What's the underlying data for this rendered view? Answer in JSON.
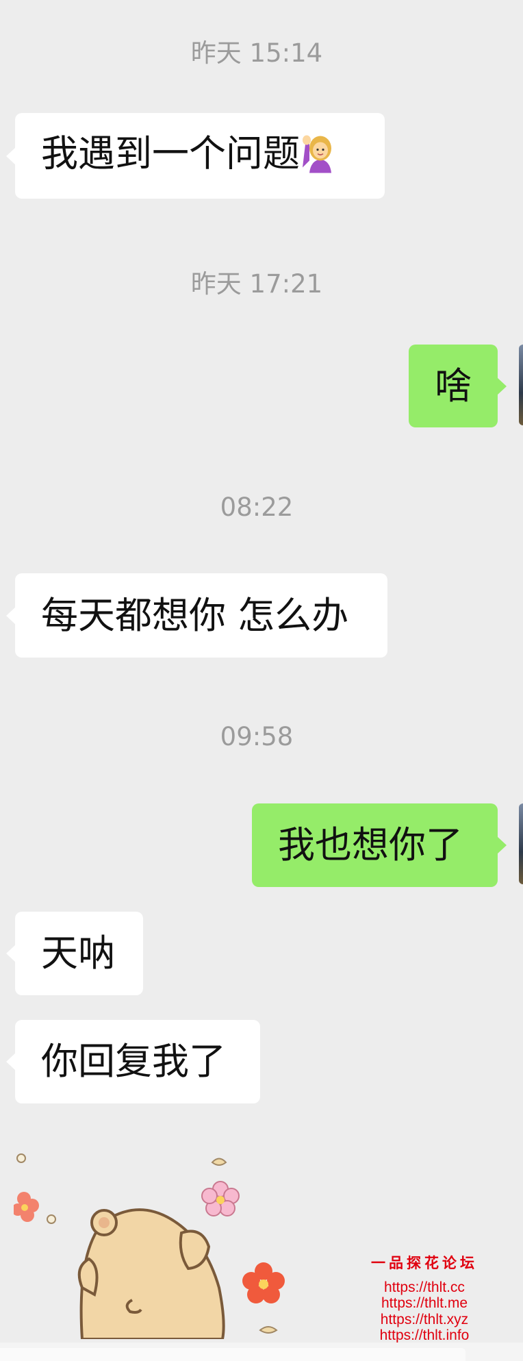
{
  "timestamps": [
    "昨天 15:14",
    "昨天 17:21",
    "08:22",
    "09:58"
  ],
  "messages": [
    {
      "side": "left",
      "text": "我遇到一个问题",
      "emoji": "woman-raising-hand-icon"
    },
    {
      "side": "right",
      "text": "啥"
    },
    {
      "side": "left",
      "text": "每天都想你 怎么办"
    },
    {
      "side": "right",
      "text": "我也想你了"
    },
    {
      "side": "left",
      "text": "天呐"
    },
    {
      "side": "left",
      "text": "你回复我了"
    }
  ],
  "sticker": {
    "icon": "shy-bear-sticker-icon"
  },
  "watermark": {
    "title": "一品探花论坛",
    "lines": [
      "https://thlt.cc",
      "https://thlt.me",
      "https://thlt.xyz",
      "https://thlt.info"
    ]
  },
  "colors": {
    "background": "#ededed",
    "bubble_left": "#ffffff",
    "bubble_right": "#95ec69",
    "watermark": "#e0000f"
  }
}
